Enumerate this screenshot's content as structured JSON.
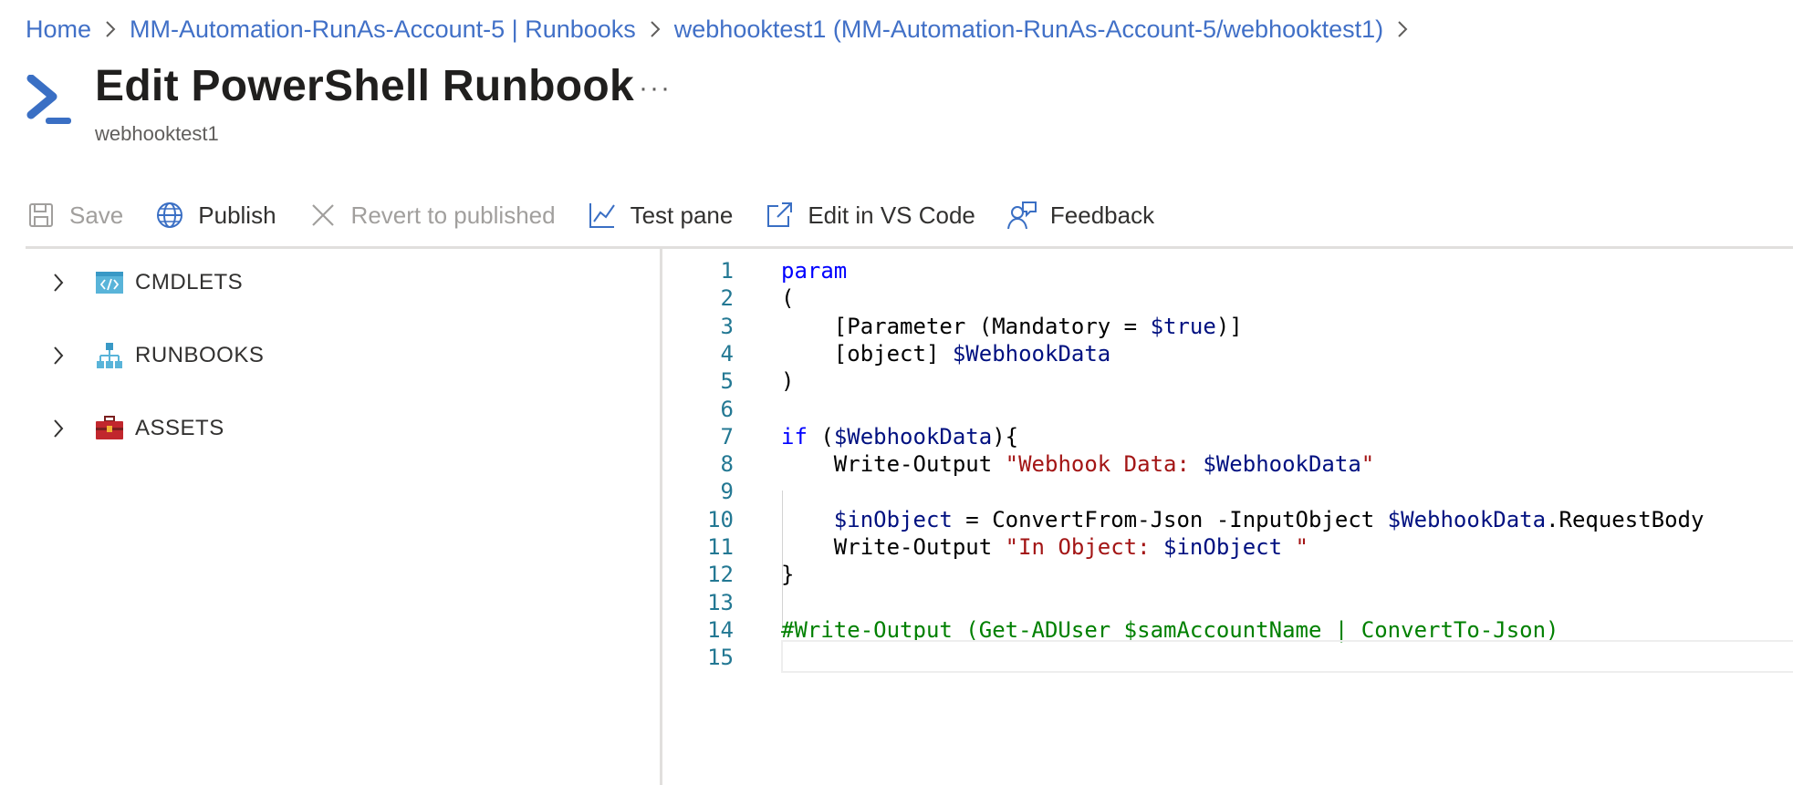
{
  "breadcrumb": {
    "items": [
      {
        "label": "Home"
      },
      {
        "label": "MM-Automation-RunAs-Account-5 | Runbooks"
      },
      {
        "label": "webhooktest1 (MM-Automation-RunAs-Account-5/webhooktest1)"
      }
    ]
  },
  "header": {
    "title": "Edit PowerShell Runbook",
    "subtitle": "webhooktest1",
    "more_label": "···",
    "icon": "powershell-icon"
  },
  "toolbar": {
    "save_label": "Save",
    "publish_label": "Publish",
    "revert_label": "Revert to published",
    "test_pane_label": "Test pane",
    "vscode_label": "Edit in VS Code",
    "feedback_label": "Feedback"
  },
  "tree": {
    "items": [
      {
        "label": "CMDLETS",
        "icon": "cmdlet-icon"
      },
      {
        "label": "RUNBOOKS",
        "icon": "runbooks-hierarchy-icon"
      },
      {
        "label": "ASSETS",
        "icon": "toolbox-icon"
      }
    ]
  },
  "colors": {
    "accent": "#4170c7",
    "keyword": "#0000ff",
    "variable": "#001080",
    "string": "#a31515",
    "comment": "#008000",
    "line_number": "#237893"
  },
  "editor": {
    "lines": [
      {
        "n": "1",
        "tokens": [
          {
            "t": "kw",
            "v": "param"
          }
        ]
      },
      {
        "n": "2",
        "tokens": [
          {
            "t": "pl",
            "v": "("
          }
        ]
      },
      {
        "n": "3",
        "tokens": [
          {
            "t": "pl",
            "v": "    [Parameter (Mandatory = "
          },
          {
            "t": "var",
            "v": "$true"
          },
          {
            "t": "pl",
            "v": ")]"
          }
        ]
      },
      {
        "n": "4",
        "tokens": [
          {
            "t": "pl",
            "v": "    [object] "
          },
          {
            "t": "var",
            "v": "$WebhookData"
          }
        ]
      },
      {
        "n": "5",
        "tokens": [
          {
            "t": "pl",
            "v": ")"
          }
        ]
      },
      {
        "n": "6",
        "tokens": []
      },
      {
        "n": "7",
        "tokens": [
          {
            "t": "kw",
            "v": "if"
          },
          {
            "t": "pl",
            "v": " ("
          },
          {
            "t": "var",
            "v": "$WebhookData"
          },
          {
            "t": "pl",
            "v": "){"
          }
        ]
      },
      {
        "n": "8",
        "tokens": [
          {
            "t": "pl",
            "v": "    Write-Output "
          },
          {
            "t": "str",
            "v": "\"Webhook Data: "
          },
          {
            "t": "var",
            "v": "$WebhookData"
          },
          {
            "t": "str",
            "v": "\""
          }
        ]
      },
      {
        "n": "9",
        "tokens": []
      },
      {
        "n": "10",
        "tokens": [
          {
            "t": "pl",
            "v": "    "
          },
          {
            "t": "var",
            "v": "$inObject"
          },
          {
            "t": "pl",
            "v": " = ConvertFrom-Json -InputObject "
          },
          {
            "t": "var",
            "v": "$WebhookData"
          },
          {
            "t": "pl",
            "v": ".RequestBody"
          }
        ]
      },
      {
        "n": "11",
        "tokens": [
          {
            "t": "pl",
            "v": "    Write-Output "
          },
          {
            "t": "str",
            "v": "\"In Object: "
          },
          {
            "t": "var",
            "v": "$inObject"
          },
          {
            "t": "str",
            "v": " \""
          }
        ]
      },
      {
        "n": "12",
        "tokens": [
          {
            "t": "pl",
            "v": "}"
          }
        ]
      },
      {
        "n": "13",
        "tokens": []
      },
      {
        "n": "14",
        "tokens": [
          {
            "t": "cmt",
            "v": "#Write-Output (Get-ADUser $samAccountName | ConvertTo-Json)"
          }
        ]
      },
      {
        "n": "15",
        "tokens": []
      }
    ]
  }
}
